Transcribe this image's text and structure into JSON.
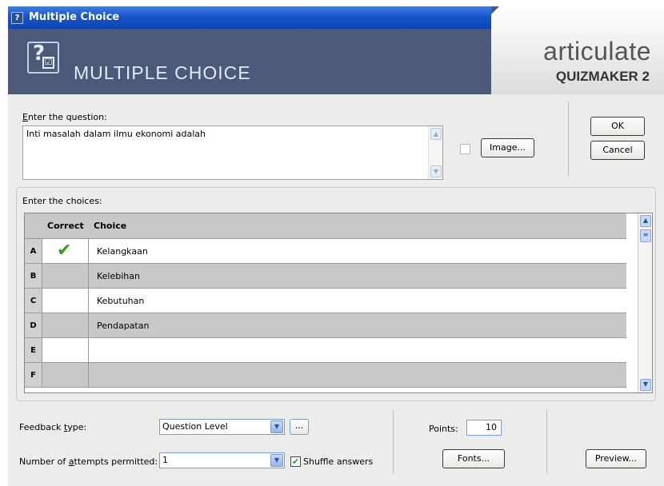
{
  "window": {
    "title": "Multiple Choice",
    "close_glyph": "✕"
  },
  "header": {
    "icon_glyph": "?",
    "icon_check": "☑",
    "title": "MULTIPLE CHOICE",
    "brand_line1": "articulate",
    "brand_line2": "QUIZMAKER 2",
    "brand_tm": "®"
  },
  "question": {
    "label_accel": "E",
    "label_rest": "nter the question:",
    "text": "Inti masalah dalam ilmu ekonomi adalah",
    "image_button": "Image..."
  },
  "actions": {
    "ok": "OK",
    "cancel": "Cancel"
  },
  "choices": {
    "label": "Enter the choices:",
    "columns": {
      "correct": "Correct",
      "choice": "Choice"
    },
    "rows": [
      {
        "letter": "A",
        "correct": true,
        "text": "Kelangkaan"
      },
      {
        "letter": "B",
        "correct": false,
        "text": "Kelebihan"
      },
      {
        "letter": "C",
        "correct": false,
        "text": "Kebutuhan"
      },
      {
        "letter": "D",
        "correct": false,
        "text": "Pendapatan"
      },
      {
        "letter": "E",
        "correct": false,
        "text": ""
      },
      {
        "letter": "F",
        "correct": false,
        "text": ""
      }
    ]
  },
  "feedback": {
    "label_pre": "Feedback ",
    "label_accel": "t",
    "label_post": "ype:",
    "value": "Question Level",
    "more_button": "..."
  },
  "attempts": {
    "label_pre": "Number of ",
    "label_accel": "a",
    "label_post": "ttempts permitted:",
    "value": "1"
  },
  "shuffle": {
    "label": "Shuffle answers",
    "checked": true
  },
  "points": {
    "label": "Points:",
    "value": "10"
  },
  "buttons": {
    "fonts": "Fonts...",
    "preview": "Preview..."
  },
  "colors": {
    "header_bg": "#4a5a78",
    "titlebar": "#1856c7",
    "check_green": "#3a9a1a"
  }
}
